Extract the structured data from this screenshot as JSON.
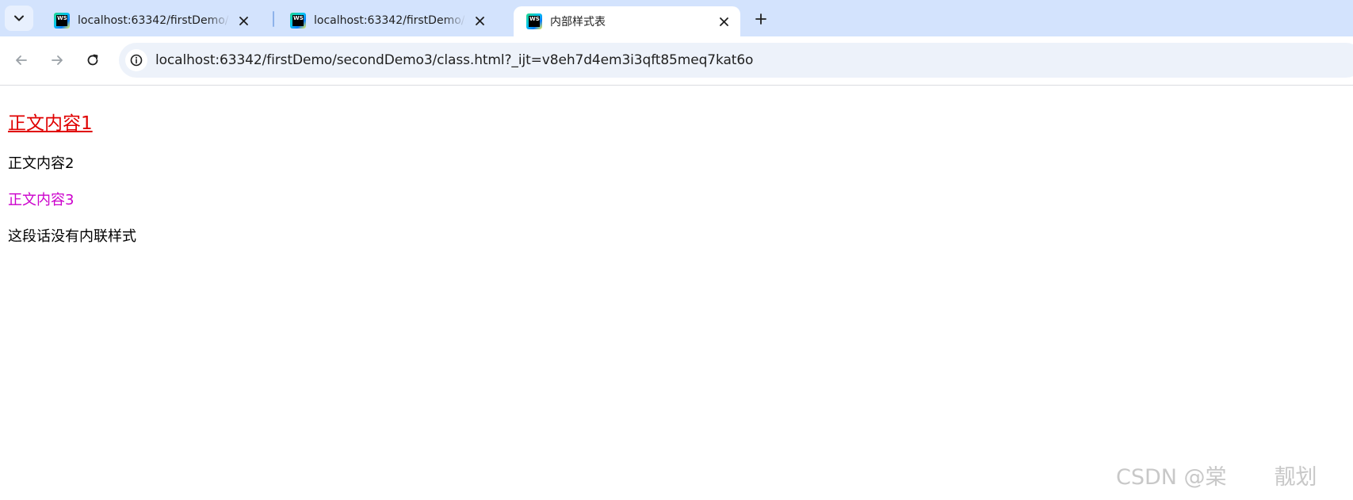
{
  "browser": {
    "tabs": [
      {
        "title": "localhost:63342/firstDemo/secondDemo3/class.html",
        "active": false,
        "favicon": "webstorm-icon"
      },
      {
        "title": "localhost:63342/firstDemo/secondDemo3/class.html",
        "active": false,
        "favicon": "webstorm-icon"
      },
      {
        "title": "内部样式表",
        "active": true,
        "favicon": "webstorm-icon"
      }
    ],
    "address": {
      "url": "localhost:63342/firstDemo/secondDemo3/class.html?_ijt=v8eh7d4em3i3qft85meq7kat6o"
    },
    "colors": {
      "tabstrip_bg": "#d3e3fd",
      "omnibox_bg": "#edf2fa"
    }
  },
  "page": {
    "paragraphs": [
      {
        "text": "正文内容1",
        "color": "#e00000"
      },
      {
        "text": "正文内容2",
        "color": "#000000"
      },
      {
        "text": "正文内容3",
        "color": "#cc00cc"
      },
      {
        "text": "这段话没有内联样式",
        "color": "#000000"
      }
    ]
  },
  "watermark": {
    "left": "CSDN @棠",
    "right": "靓划"
  }
}
